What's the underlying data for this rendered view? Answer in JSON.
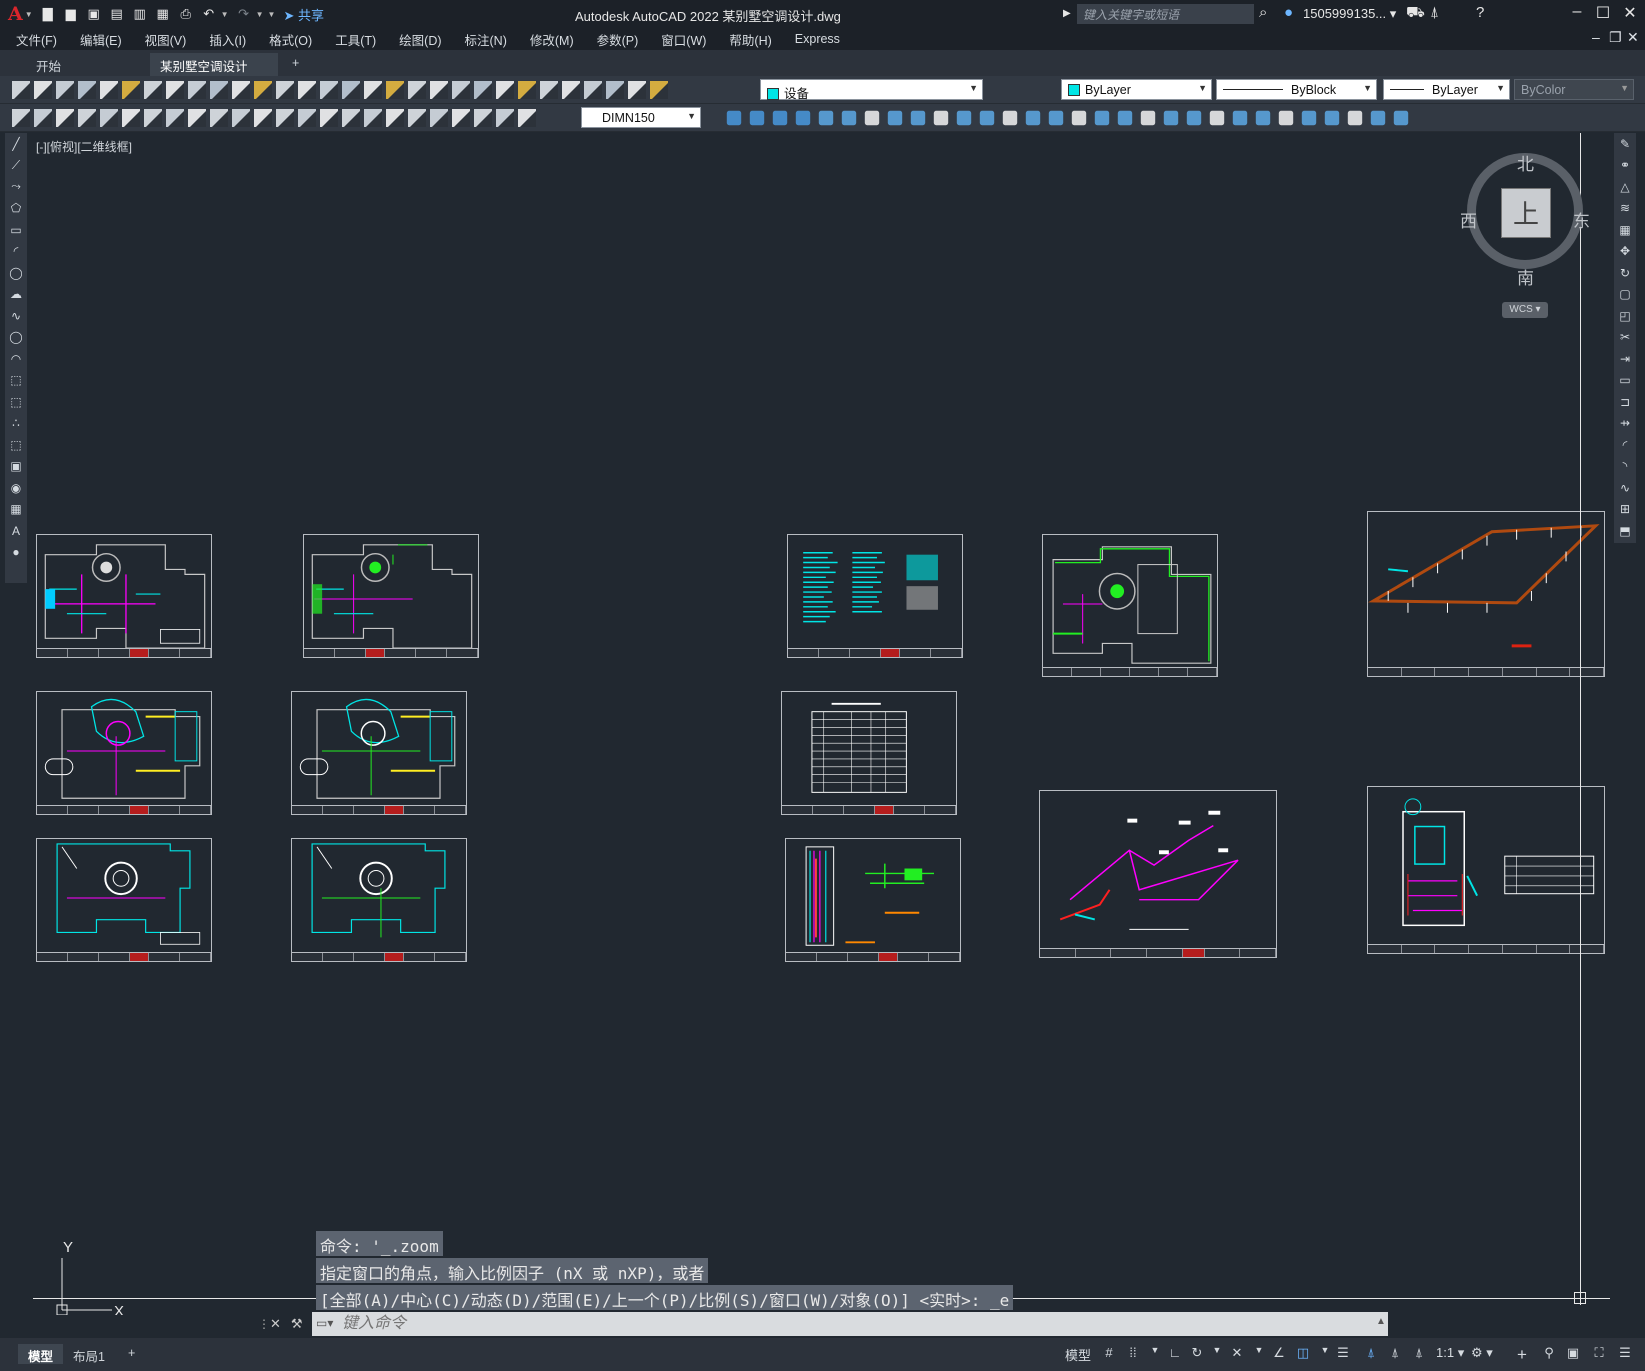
{
  "app": {
    "title": "Autodesk AutoCAD 2022    某别墅空调设计.dwg",
    "logo": "A",
    "share_label": "共享",
    "search_placeholder": "键入关键字或短语",
    "user": "1505999135...",
    "accent": "#d8262c"
  },
  "menu": [
    "文件(F)",
    "编辑(E)",
    "视图(V)",
    "插入(I)",
    "格式(O)",
    "工具(T)",
    "绘图(D)",
    "标注(N)",
    "修改(M)",
    "参数(P)",
    "窗口(W)",
    "帮助(H)",
    "Express"
  ],
  "tabs": [
    {
      "label": "开始"
    },
    {
      "label": "某别墅空调设计*"
    }
  ],
  "toolbar": {
    "layer": "设备",
    "color": "ByLayer",
    "linetype": "ByBlock",
    "lineweight": "ByLayer",
    "plotstyle": "ByColor",
    "dimstyle": "DIMN150"
  },
  "viewport_label": "[-][俯视][二维线框]",
  "viewcube": {
    "face": "上",
    "north": "北",
    "south": "南",
    "east": "东",
    "west": "西",
    "wcs": "WCS"
  },
  "ucs": {
    "x": "X",
    "y": "Y"
  },
  "command": {
    "history": [
      "命令: '_.zoom",
      "指定窗口的角点，输入比例因子 (nX 或 nXP)，或者",
      "[全部(A)/中心(C)/动态(D)/范围(E)/上一个(P)/比例(S)/窗口(W)/对象(O)] <实时>: _e"
    ],
    "placeholder": "键入命令"
  },
  "layouts": [
    {
      "label": "模型"
    },
    {
      "label": "布局1"
    }
  ],
  "status": {
    "model": "模型",
    "scale": "1:1"
  }
}
